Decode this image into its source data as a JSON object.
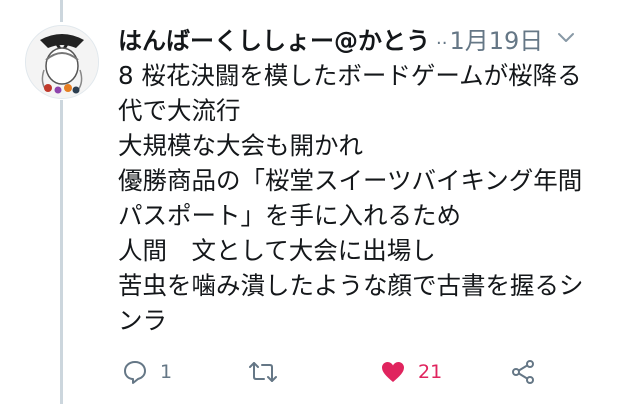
{
  "tweet": {
    "author": "はんばーくししょー@かとう",
    "dots": "..",
    "time": "1月19日",
    "lines": [
      "8 桜花決闘を模したボードゲームが桜降る",
      "代で大流行",
      "大規模な大会も開かれ",
      "優勝商品の「桜堂スイーツバイキング年間",
      "パスポート」を手に入れるため",
      "人間　文として大会に出場し",
      "苦虫を噛み潰したような顔で古書を握るシ",
      "ンラ"
    ]
  },
  "actions": {
    "reply": {
      "icon": "reply-icon",
      "count": "1"
    },
    "retweet": {
      "icon": "retweet-icon",
      "count": ""
    },
    "like": {
      "icon": "heart-icon",
      "count": "21"
    },
    "share": {
      "icon": "share-icon"
    }
  },
  "colors": {
    "text": "#14171a",
    "muted": "#657786",
    "like": "#e0245e",
    "thread_line": "#ccd6dd"
  }
}
